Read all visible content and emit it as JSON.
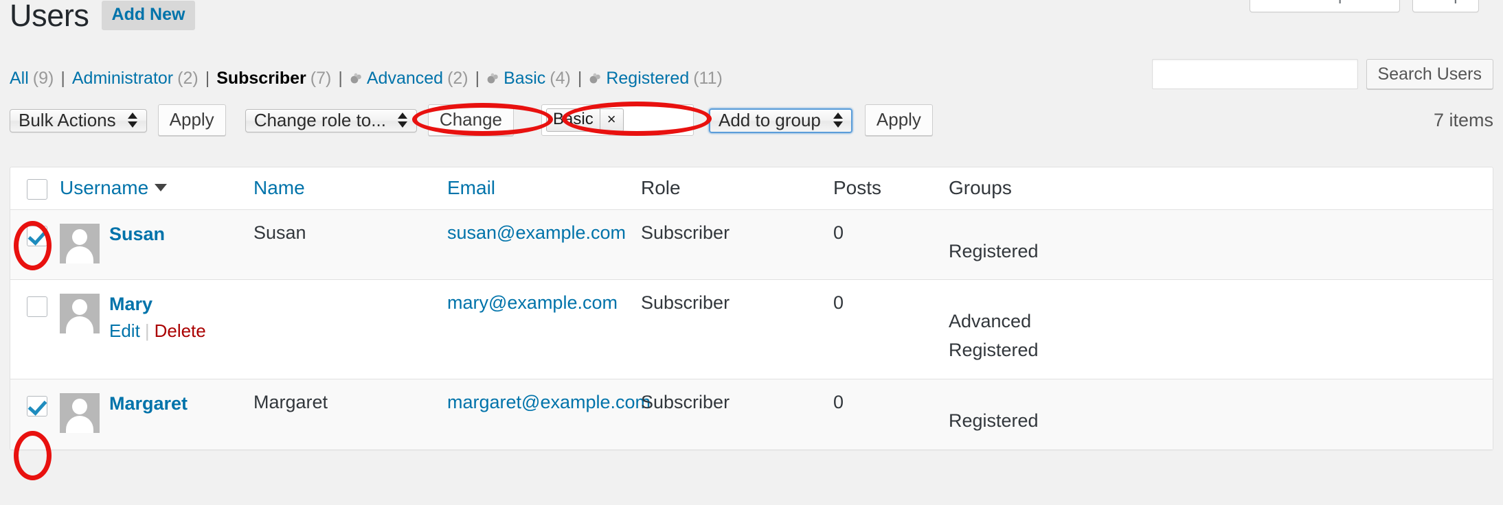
{
  "screen_meta": {
    "screen_options_label": "Screen Options",
    "help_label": "Help"
  },
  "header": {
    "page_title": "Users",
    "add_new_label": "Add New"
  },
  "filters": [
    {
      "label": "All",
      "count": "(9)",
      "current": false,
      "has_group_icon": false
    },
    {
      "label": "Administrator",
      "count": "(2)",
      "current": false,
      "has_group_icon": false
    },
    {
      "label": "Subscriber",
      "count": "(7)",
      "current": true,
      "has_group_icon": false
    },
    {
      "label": "Advanced",
      "count": "(2)",
      "current": false,
      "has_group_icon": true
    },
    {
      "label": "Basic",
      "count": "(4)",
      "current": false,
      "has_group_icon": true
    },
    {
      "label": "Registered",
      "count": "(11)",
      "current": false,
      "has_group_icon": true
    }
  ],
  "search": {
    "value": "",
    "placeholder": "",
    "button_label": "Search Users"
  },
  "tablenav": {
    "bulk_actions_value": "Bulk Actions",
    "bulk_apply_label": "Apply",
    "change_role_value": "Change role to...",
    "change_label": "Change",
    "group_token_label": "Basic",
    "group_token_remove": "×",
    "add_to_group_value": "Add to group",
    "group_apply_label": "Apply",
    "items_count": "7 items"
  },
  "table": {
    "columns": [
      {
        "label": "Username",
        "sortable": true,
        "link": true
      },
      {
        "label": "Name",
        "sortable": false,
        "link": true
      },
      {
        "label": "Email",
        "sortable": false,
        "link": true
      },
      {
        "label": "Role",
        "sortable": false,
        "link": false
      },
      {
        "label": "Posts",
        "sortable": false,
        "link": false
      },
      {
        "label": "Groups",
        "sortable": false,
        "link": false
      }
    ],
    "select_all_checked": false,
    "rows": [
      {
        "checked": true,
        "username": "Susan",
        "name": "Susan",
        "email": "susan@example.com",
        "role": "Subscriber",
        "posts": "0",
        "groups": [
          "Registered"
        ],
        "actions": null
      },
      {
        "checked": false,
        "username": "Mary",
        "name": "",
        "email": "mary@example.com",
        "role": "Subscriber",
        "posts": "0",
        "groups": [
          "Advanced",
          "Registered"
        ],
        "actions": {
          "edit_label": "Edit",
          "separator": "|",
          "delete_label": "Delete"
        }
      },
      {
        "checked": true,
        "username": "Margaret",
        "name": "Margaret",
        "email": "margaret@example.com",
        "role": "Subscriber",
        "posts": "0",
        "groups": [
          "Registered"
        ],
        "actions": null
      }
    ]
  },
  "annotations": {
    "color": "#e8110f",
    "shapes": [
      {
        "name": "group-token-highlight",
        "target": "group_token"
      },
      {
        "name": "add-to-group-highlight",
        "target": "add_to_group_select"
      },
      {
        "name": "row1-checkbox-highlight",
        "target": "row_0_checkbox"
      },
      {
        "name": "row3-checkbox-highlight",
        "target": "row_2_checkbox"
      }
    ]
  },
  "colors": {
    "link": "#0073aa",
    "delete": "#a00",
    "page_bg": "#f1f1f1",
    "row_alt": "#f9f9f9",
    "annotation": "#e8110f"
  }
}
